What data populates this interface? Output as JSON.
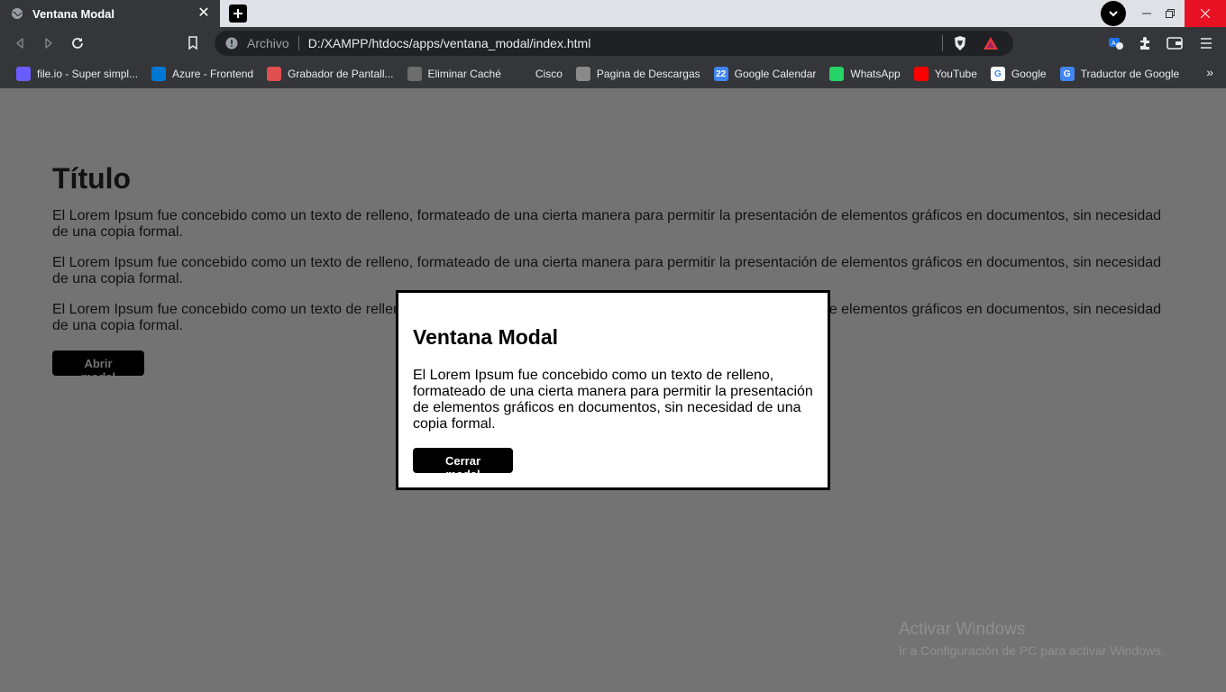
{
  "tab": {
    "title": "Ventana Modal"
  },
  "toolbar": {
    "scheme": "Archivo",
    "url": "D:/XAMPP/htdocs/apps/ventana_modal/index.html"
  },
  "bookmarks": [
    {
      "label": "file.io - Super simpl...",
      "icon": "file-io-icon",
      "color": "#6b5cff"
    },
    {
      "label": "Azure - Frontend",
      "icon": "azure-devops-icon",
      "color": "#0078d4"
    },
    {
      "label": "Grabador de Pantall...",
      "icon": "screen-recorder-icon",
      "color": "#e05050"
    },
    {
      "label": "Eliminar Caché",
      "icon": "gear-icon",
      "color": "#6d6d6d"
    },
    {
      "label": "Cisco",
      "icon": "cisco-icon",
      "color": "#35363a"
    },
    {
      "label": "Pagina de Descargas",
      "icon": "globe-icon",
      "color": "#8a8a8a"
    },
    {
      "label": "Google Calendar",
      "icon": "google-calendar-icon",
      "color": "#4285f4",
      "glyph": "22"
    },
    {
      "label": "WhatsApp",
      "icon": "whatsapp-icon",
      "color": "#25d366"
    },
    {
      "label": "YouTube",
      "icon": "youtube-icon",
      "color": "#ff0000"
    },
    {
      "label": "Google",
      "icon": "google-icon",
      "color": "#ffffff",
      "glyph": "G"
    },
    {
      "label": "Traductor de Google",
      "icon": "google-translate-icon",
      "color": "#4285f4",
      "glyph": "G"
    }
  ],
  "page": {
    "title": "Título",
    "paragraphs": [
      "El Lorem Ipsum fue concebido como un texto de relleno, formateado de una cierta manera para permitir la presentación de elementos gráficos en documentos, sin necesidad de una copia formal.",
      "El Lorem Ipsum fue concebido como un texto de relleno, formateado de una cierta manera para permitir la presentación de elementos gráficos en documentos, sin necesidad de una copia formal.",
      "El Lorem Ipsum fue concebido como un texto de relleno, formateado de una cierta manera para permitir la presentación de elementos gráficos en documentos, sin necesidad de una copia formal."
    ],
    "open_button": "Abrir modal"
  },
  "modal": {
    "title": "Ventana Modal",
    "text": "El Lorem Ipsum fue concebido como un texto de relleno, formateado de una cierta manera para permitir la presentación de elementos gráficos en documentos, sin necesidad de una copia formal.",
    "close_button": "Cerrar modal"
  },
  "watermark": {
    "line1": "Activar Windows",
    "line2": "Ir a Configuración de PC para activar Windows."
  }
}
